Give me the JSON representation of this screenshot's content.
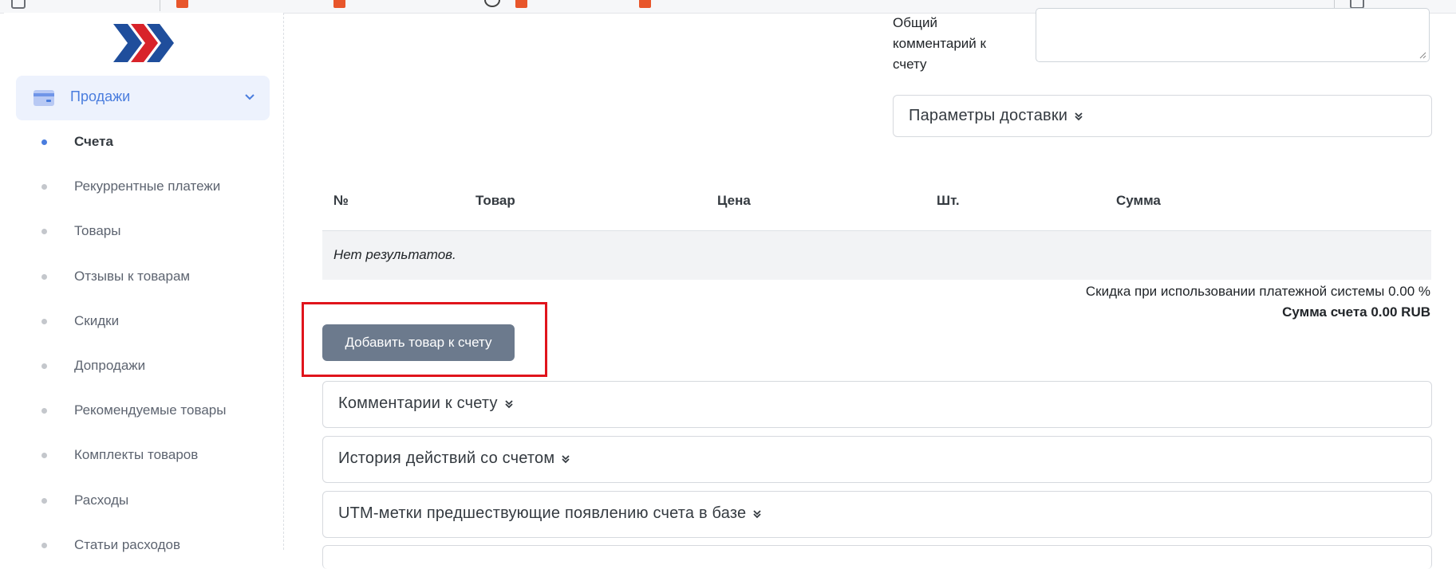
{
  "sidebar": {
    "group": {
      "label": "Продажи"
    },
    "items": [
      {
        "label": "Счета",
        "active": true
      },
      {
        "label": "Рекуррентные платежи"
      },
      {
        "label": "Товары"
      },
      {
        "label": "Отзывы к товарам"
      },
      {
        "label": "Скидки"
      },
      {
        "label": "Допродажи"
      },
      {
        "label": "Рекомендуемые товары"
      },
      {
        "label": "Комплекты товаров"
      },
      {
        "label": "Расходы"
      },
      {
        "label": "Статьи расходов"
      }
    ]
  },
  "main": {
    "comment_label": "Общий комментарий к счету",
    "delivery": {
      "title": "Параметры доставки"
    },
    "table": {
      "headers": [
        "№",
        "Товар",
        "Цена",
        "Шт.",
        "Сумма"
      ],
      "empty_text": "Нет результатов."
    },
    "discount_text": "Скидка при использовании платежной системы 0.00 %",
    "total_text": "Сумма счета 0.00 RUB",
    "add_button": "Добавить товар к счету",
    "accordions": [
      {
        "title": "Комментарии к счету"
      },
      {
        "title": "История действий со счетом"
      },
      {
        "title": "UTM-метки предшествующие появлению счета в базе"
      }
    ]
  },
  "colors": {
    "accent": "#4a7dde",
    "button": "#6c7a8d",
    "highlight": "#e0141c",
    "logo_blue": "#1f4e9c",
    "logo_red": "#d8232a"
  }
}
